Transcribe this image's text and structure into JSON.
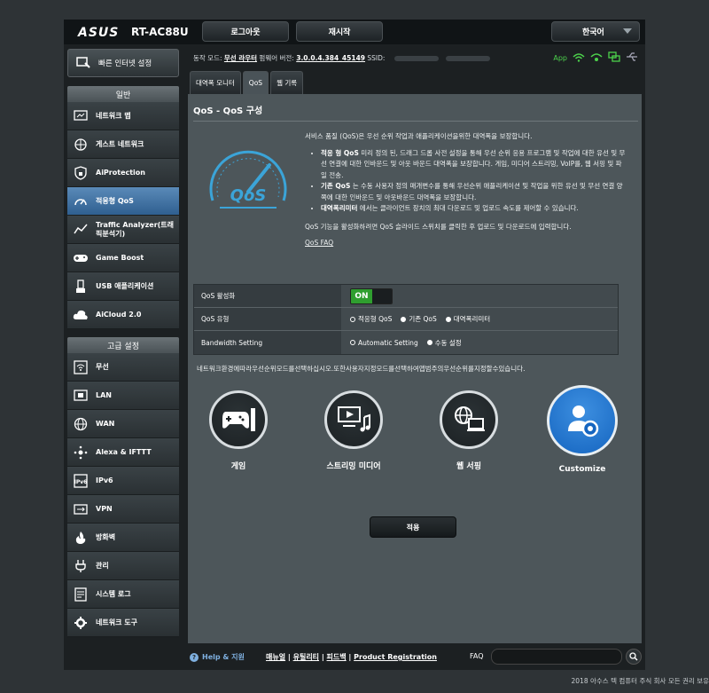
{
  "header": {
    "brand": "ASUS",
    "model": "RT-AC88U",
    "logout": "로그아웃",
    "reboot": "재시작",
    "language": "한국어"
  },
  "sidebar": {
    "quick_setup": "빠른 인터넷 설정",
    "general_title": "일반",
    "general": [
      {
        "label": "네트워크 맵",
        "icon": "network-map-icon"
      },
      {
        "label": "게스트 네트워크",
        "icon": "guest-network-icon"
      },
      {
        "label": "AiProtection",
        "icon": "shield-icon"
      },
      {
        "label": "적응형 QoS",
        "icon": "qos-icon"
      },
      {
        "label": "Traffic Analyzer(트래픽분석기)",
        "icon": "traffic-analyzer-icon"
      },
      {
        "label": "Game Boost",
        "icon": "gamepad-icon"
      },
      {
        "label": "USB 애플리케이션",
        "icon": "usb-icon"
      },
      {
        "label": "AiCloud 2.0",
        "icon": "cloud-icon"
      }
    ],
    "advanced_title": "고급 설정",
    "advanced": [
      {
        "label": "무선",
        "icon": "wireless-icon"
      },
      {
        "label": "LAN",
        "icon": "lan-icon"
      },
      {
        "label": "WAN",
        "icon": "wan-icon"
      },
      {
        "label": "Alexa & IFTTT",
        "icon": "alexa-icon"
      },
      {
        "label": "IPv6",
        "icon": "ipv6-icon"
      },
      {
        "label": "VPN",
        "icon": "vpn-icon"
      },
      {
        "label": "방화벽",
        "icon": "firewall-icon"
      },
      {
        "label": "관리",
        "icon": "admin-icon"
      },
      {
        "label": "시스템 로그",
        "icon": "system-log-icon"
      },
      {
        "label": "네트워크 도구",
        "icon": "network-tools-icon"
      }
    ]
  },
  "status": {
    "op_mode_label": "동작 모드:",
    "op_mode_value": "무선 라우터",
    "firmware_label": "펌웨어 버전:",
    "firmware_value": "3.0.0.4.384_45149",
    "ssid_label": "SSID:",
    "app_label": "App"
  },
  "tabs": [
    "대역폭 모니터",
    "QoS",
    "웹 기록"
  ],
  "panel": {
    "title": "QoS - QoS 구성",
    "intro": "서비스 품질 (QoS)은 우선 순위 작업과 애플리케이션을위한 대역폭을 보장합니다.",
    "bullets": [
      {
        "term": "적응 형 QoS",
        "text": " 미리 정의 된, 드래그 드롭 사전 설정을 통해 우선 순위 응용 프로그램 및 작업에 대한 유선 및 무선 연결에 대한 인바운드 및 아웃 바운드 대역폭을 보장합니다. 게임, 미디어 스트리밍, VoIP를, 웹 서핑 및 파일 전송."
      },
      {
        "term": "기존 QoS",
        "text": " 는 수동 사용자 정의 매개변수를 통해 우선순위 애플리케이션 및 작업을 위한 유선 및 무선 연결 양쪽에 대한 인바운드 및 아웃바운드 대역폭을 보장합니다."
      },
      {
        "term": "대역폭리미터",
        "text": " 에서는 클라이언트 장치의 최대 다운로드 및 업로드 속도를 제어할 수 있습니다."
      }
    ],
    "enable_hint": "QoS 기능을 활성화하려면 QoS 슬라이드 스위치를 클릭한 후 업로드 및 다운로드에 입력합니다.",
    "faq_link": "QoS FAQ",
    "gauge_text": "QoS"
  },
  "settings": {
    "enable_label": "QoS 활성화",
    "toggle_on": "ON",
    "type_label": "QoS 유형",
    "type_options": [
      {
        "label": "적응형 QoS",
        "selected": false
      },
      {
        "label": "기존 QoS",
        "selected": true
      },
      {
        "label": "대역폭리미터",
        "selected": true
      }
    ],
    "bw_label": "Bandwidth Setting",
    "bw_options": [
      {
        "label": "Automatic Setting",
        "selected": false
      },
      {
        "label": "수동 설정",
        "selected": true
      }
    ]
  },
  "mode_hint": "네트워크환경에따라우선순위모드를선택하십시오.또한사용자지정모드를선택하여앱범주의우선순위를지정할수있습니다.",
  "categories": [
    {
      "label": "게임",
      "icon": "game-icon",
      "selected": false
    },
    {
      "label": "스트리밍 미디어",
      "icon": "streaming-media-icon",
      "selected": false
    },
    {
      "label": "웹 서핑",
      "icon": "web-surfing-icon",
      "selected": false
    },
    {
      "label": "Customize",
      "icon": "customize-icon",
      "selected": true
    }
  ],
  "apply_label": "적용",
  "footer": {
    "help": "Help & 지원",
    "links": [
      "매뉴얼",
      "유틸리티",
      "피드백",
      "Product Registration"
    ],
    "faq": "FAQ",
    "copyright": "2018 아수스 텍 컴퓨터 주식 회사 모든 권리 보유"
  },
  "colors": {
    "accent": "#2f5f90",
    "toggle_on": "#2f9e2f",
    "status_icon": "#4cd14c",
    "help_link": "#7fb0e0"
  }
}
